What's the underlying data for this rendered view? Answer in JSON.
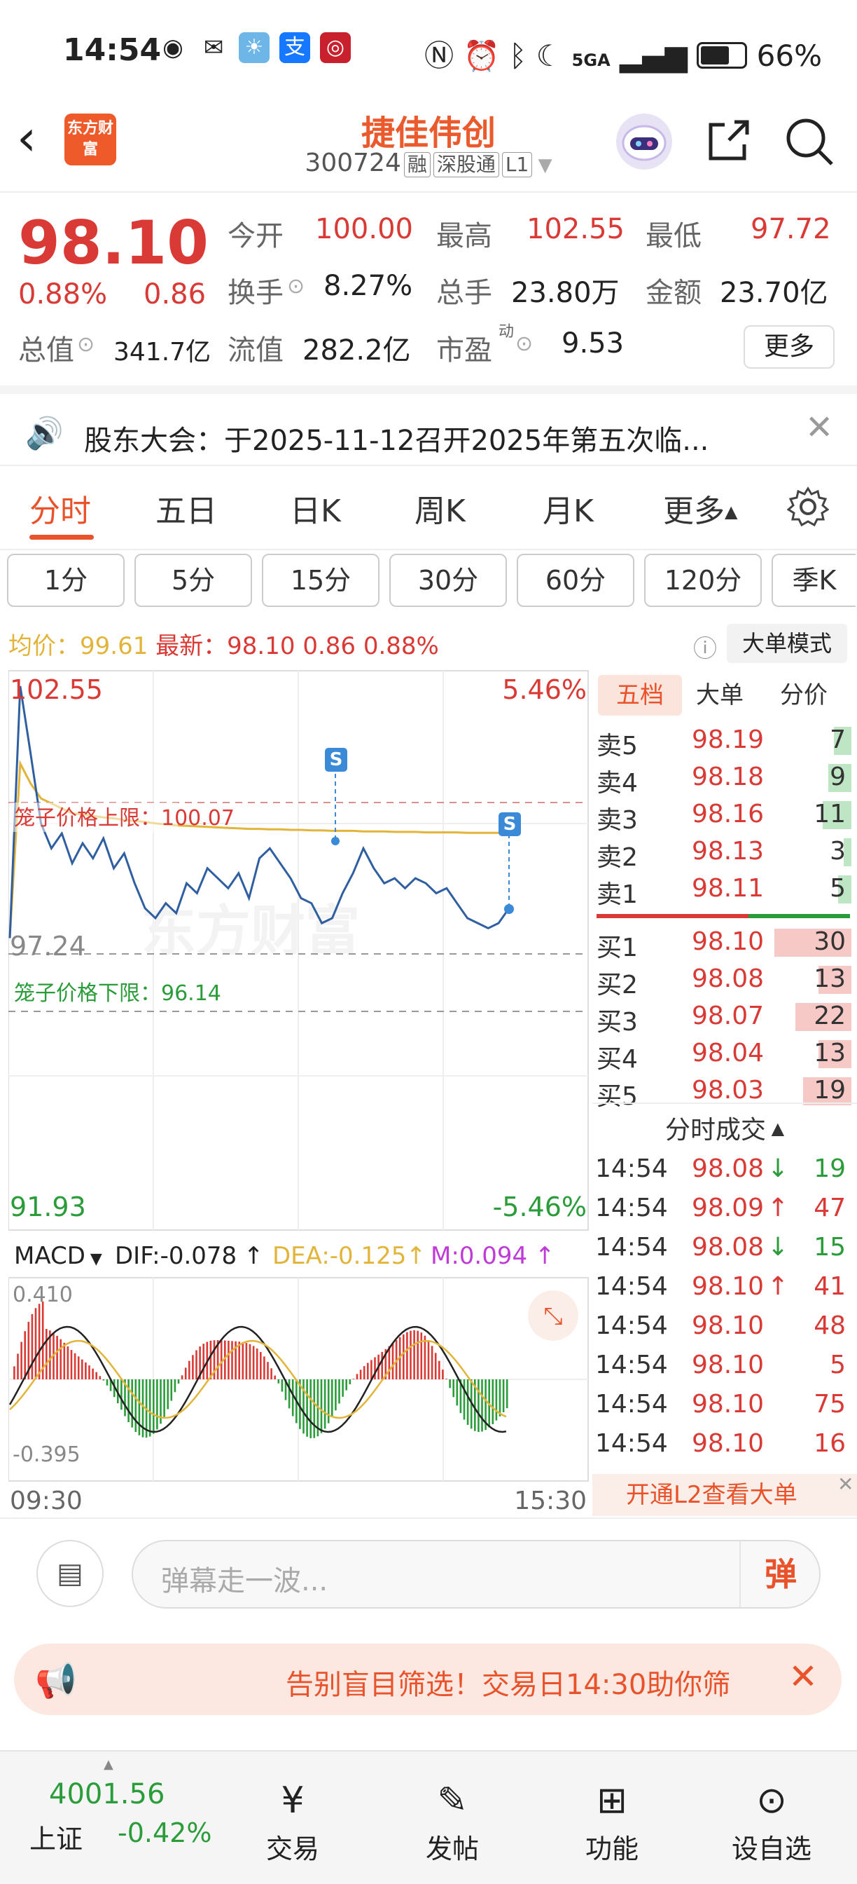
{
  "status": {
    "time": "14:54",
    "signal": "5GA",
    "battery": "66%"
  },
  "header": {
    "back_icon": "back-arrow-icon",
    "logo_text": "东方财富",
    "name": "捷佳伟创",
    "code": "300724",
    "tag_margin": "融",
    "tag_connect": "深股通",
    "tag_level": "L1"
  },
  "quote": {
    "price": "98.10",
    "change_pct": "0.88%",
    "change": "0.86",
    "open_label": "今开",
    "open": "100.00",
    "high_label": "最高",
    "high": "102.55",
    "low_label": "最低",
    "low": "97.72",
    "turnover_label": "换手",
    "turnover": "8.27%",
    "volume_label": "总手",
    "volume": "23.80万",
    "amount_label": "金额",
    "amount": "23.70亿",
    "mcap_label": "总值",
    "mcap": "341.7亿",
    "float_label": "流值",
    "float": "282.2亿",
    "pe_label": "市盈",
    "pe_sup": "动",
    "pe": "9.53",
    "more": "更多"
  },
  "notice": {
    "text": "股东大会：于2025-11-12召开2025年第五次临..."
  },
  "tabs": [
    "分时",
    "五日",
    "日K",
    "周K",
    "月K",
    "更多"
  ],
  "periods": [
    "1分",
    "5分",
    "15分",
    "30分",
    "60分",
    "120分",
    "季K"
  ],
  "info": {
    "avg_label": "均价：",
    "avg": "99.61",
    "latest_label": "最新：",
    "latest": "98.10",
    "change": "0.86",
    "pct": "0.88%",
    "mode": "大单模式"
  },
  "chart": {
    "ymax": "102.55",
    "ymin": "91.93",
    "pmax": "5.46%",
    "pmin": "-5.46%",
    "prev": "97.24",
    "upper_label": "笼子价格上限：",
    "upper": "100.07",
    "lower_label": "笼子价格下限：",
    "lower": "96.14",
    "overlay": "笼子价格",
    "watermark": "东方财富",
    "macd_label": "MACD",
    "dif": "DIF:-0.078",
    "dea": "DEA:-0.125",
    "m": "M:0.094",
    "macd_top": "0.410",
    "macd_bot": "-0.395",
    "t_start": "09:30",
    "t_end": "15:30",
    "s_marker": "S"
  },
  "chart_data": {
    "type": "line",
    "title": "",
    "x_range": [
      "09:30",
      "15:30"
    ],
    "ylim": [
      91.93,
      102.55
    ],
    "prev_close": 97.24,
    "series": [
      {
        "values": [
          97.5,
          102.55,
          101.2,
          99.8,
          99.3,
          99.6,
          99.0,
          99.4,
          99.1,
          99.5,
          98.9,
          99.2,
          98.6,
          98.1,
          97.9,
          98.2,
          98.0,
          98.6,
          98.4,
          98.9,
          98.7,
          98.5,
          98.8,
          98.3,
          99.1,
          99.3,
          99.0,
          98.7,
          98.3,
          98.2,
          97.8,
          97.9,
          98.4,
          98.8,
          99.3,
          98.9,
          98.6,
          98.7,
          98.5,
          98.7,
          98.6,
          98.4,
          98.5,
          98.2,
          97.9,
          97.8,
          97.7,
          97.8,
          98.1
        ]
      },
      {
        "values": [
          97.5,
          101.0,
          100.6,
          100.3,
          100.2,
          100.1,
          100.0,
          99.98,
          99.95,
          99.92,
          99.9,
          99.87,
          99.85,
          99.83,
          99.8,
          99.78,
          99.76,
          99.75,
          99.74,
          99.73,
          99.72,
          99.71,
          99.7,
          99.69,
          99.69,
          99.68,
          99.68,
          99.67,
          99.67,
          99.66,
          99.66,
          99.65,
          99.65,
          99.65,
          99.64,
          99.64,
          99.64,
          99.63,
          99.63,
          99.63,
          99.62,
          99.62,
          99.62,
          99.62,
          99.61,
          99.61,
          99.61,
          99.61,
          99.61
        ]
      }
    ]
  },
  "orderbook": {
    "tabs": [
      "五档",
      "大单",
      "分价"
    ],
    "sells": [
      {
        "label": "卖5",
        "price": "98.19",
        "vol": "7",
        "bar": 0.23
      },
      {
        "label": "卖4",
        "price": "98.18",
        "vol": "9",
        "bar": 0.3
      },
      {
        "label": "卖3",
        "price": "98.16",
        "vol": "11",
        "bar": 0.37
      },
      {
        "label": "卖2",
        "price": "98.13",
        "vol": "3",
        "bar": 0.1
      },
      {
        "label": "卖1",
        "price": "98.11",
        "vol": "5",
        "bar": 0.17
      }
    ],
    "buys": [
      {
        "label": "买1",
        "price": "98.10",
        "vol": "30",
        "bar": 1.0
      },
      {
        "label": "买2",
        "price": "98.08",
        "vol": "13",
        "bar": 0.43
      },
      {
        "label": "买3",
        "price": "98.07",
        "vol": "22",
        "bar": 0.73
      },
      {
        "label": "买4",
        "price": "98.04",
        "vol": "13",
        "bar": 0.43
      },
      {
        "label": "买5",
        "price": "98.03",
        "vol": "19",
        "bar": 0.63
      }
    ],
    "trades_title": "分时成交",
    "trades": [
      {
        "time": "14:54",
        "price": "98.08",
        "dir": "↓",
        "vol": "19"
      },
      {
        "time": "14:54",
        "price": "98.09",
        "dir": "↑",
        "vol": "47"
      },
      {
        "time": "14:54",
        "price": "98.08",
        "dir": "↓",
        "vol": "15"
      },
      {
        "time": "14:54",
        "price": "98.10",
        "dir": "↑",
        "vol": "41"
      },
      {
        "time": "14:54",
        "price": "98.10",
        "dir": "",
        "vol": "48"
      },
      {
        "time": "14:54",
        "price": "98.10",
        "dir": "",
        "vol": "5"
      },
      {
        "time": "14:54",
        "price": "98.10",
        "dir": "",
        "vol": "75"
      },
      {
        "time": "14:54",
        "price": "98.10",
        "dir": "",
        "vol": "16"
      }
    ],
    "l2": "开通L2查看大单"
  },
  "comment": {
    "placeholder": "弹幕走一波...",
    "danmu": "弹"
  },
  "ad": {
    "text": "告别盲目筛选！交易日14:30助你筛"
  },
  "nav": {
    "index_value": "4001.56",
    "index_name": "上证",
    "index_pct": "-0.42%",
    "items": [
      "交易",
      "发帖",
      "功能",
      "设自选"
    ]
  },
  "colors": {
    "up": "#d93a35",
    "down": "#2b9c3a",
    "accent": "#e8532b",
    "line": "#2f5fa0",
    "avg": "#e2b43a"
  }
}
